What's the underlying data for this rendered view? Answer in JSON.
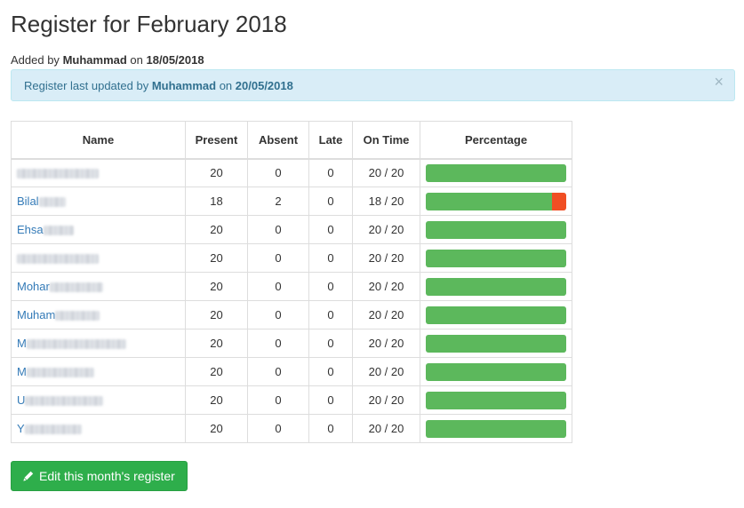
{
  "page": {
    "title": "Register for February 2018"
  },
  "added_by": {
    "prefix": "Added by",
    "user": "Muhammad",
    "on": "on",
    "date": "18/05/2018"
  },
  "alert": {
    "prefix": "Register last updated by",
    "user": "Muhammad",
    "on": "on",
    "date": "20/05/2018",
    "close": "×"
  },
  "table": {
    "headers": [
      "Name",
      "Present",
      "Absent",
      "Late",
      "On Time",
      "Percentage"
    ],
    "rows": [
      {
        "name": "",
        "present": "20",
        "absent": "0",
        "late": "0",
        "on_time": "20 / 20",
        "pct_present": 1.0,
        "pct_absent": 0.0
      },
      {
        "name": "Bilal",
        "present": "18",
        "absent": "2",
        "late": "0",
        "on_time": "18 / 20",
        "pct_present": 0.9,
        "pct_absent": 0.1
      },
      {
        "name": "Ehsa",
        "present": "20",
        "absent": "0",
        "late": "0",
        "on_time": "20 / 20",
        "pct_present": 1.0,
        "pct_absent": 0.0
      },
      {
        "name": "",
        "present": "20",
        "absent": "0",
        "late": "0",
        "on_time": "20 / 20",
        "pct_present": 1.0,
        "pct_absent": 0.0
      },
      {
        "name": "Mohar",
        "present": "20",
        "absent": "0",
        "late": "0",
        "on_time": "20 / 20",
        "pct_present": 1.0,
        "pct_absent": 0.0
      },
      {
        "name": "Muham",
        "present": "20",
        "absent": "0",
        "late": "0",
        "on_time": "20 / 20",
        "pct_present": 1.0,
        "pct_absent": 0.0
      },
      {
        "name": "M",
        "present": "20",
        "absent": "0",
        "late": "0",
        "on_time": "20 / 20",
        "pct_present": 1.0,
        "pct_absent": 0.0
      },
      {
        "name": "M",
        "present": "20",
        "absent": "0",
        "late": "0",
        "on_time": "20 / 20",
        "pct_present": 1.0,
        "pct_absent": 0.0
      },
      {
        "name": "U",
        "present": "20",
        "absent": "0",
        "late": "0",
        "on_time": "20 / 20",
        "pct_present": 1.0,
        "pct_absent": 0.0
      },
      {
        "name": "Y",
        "present": "20",
        "absent": "0",
        "late": "0",
        "on_time": "20 / 20",
        "pct_present": 1.0,
        "pct_absent": 0.0
      }
    ]
  },
  "edit_button": {
    "label": "Edit this month's register",
    "icon": "pencil-icon"
  },
  "colors": {
    "present_bar": "#5cb85c",
    "absent_bar": "#f04e23",
    "link": "#337ab7",
    "alert_bg": "#d9edf7",
    "button": "#2eae4b"
  }
}
